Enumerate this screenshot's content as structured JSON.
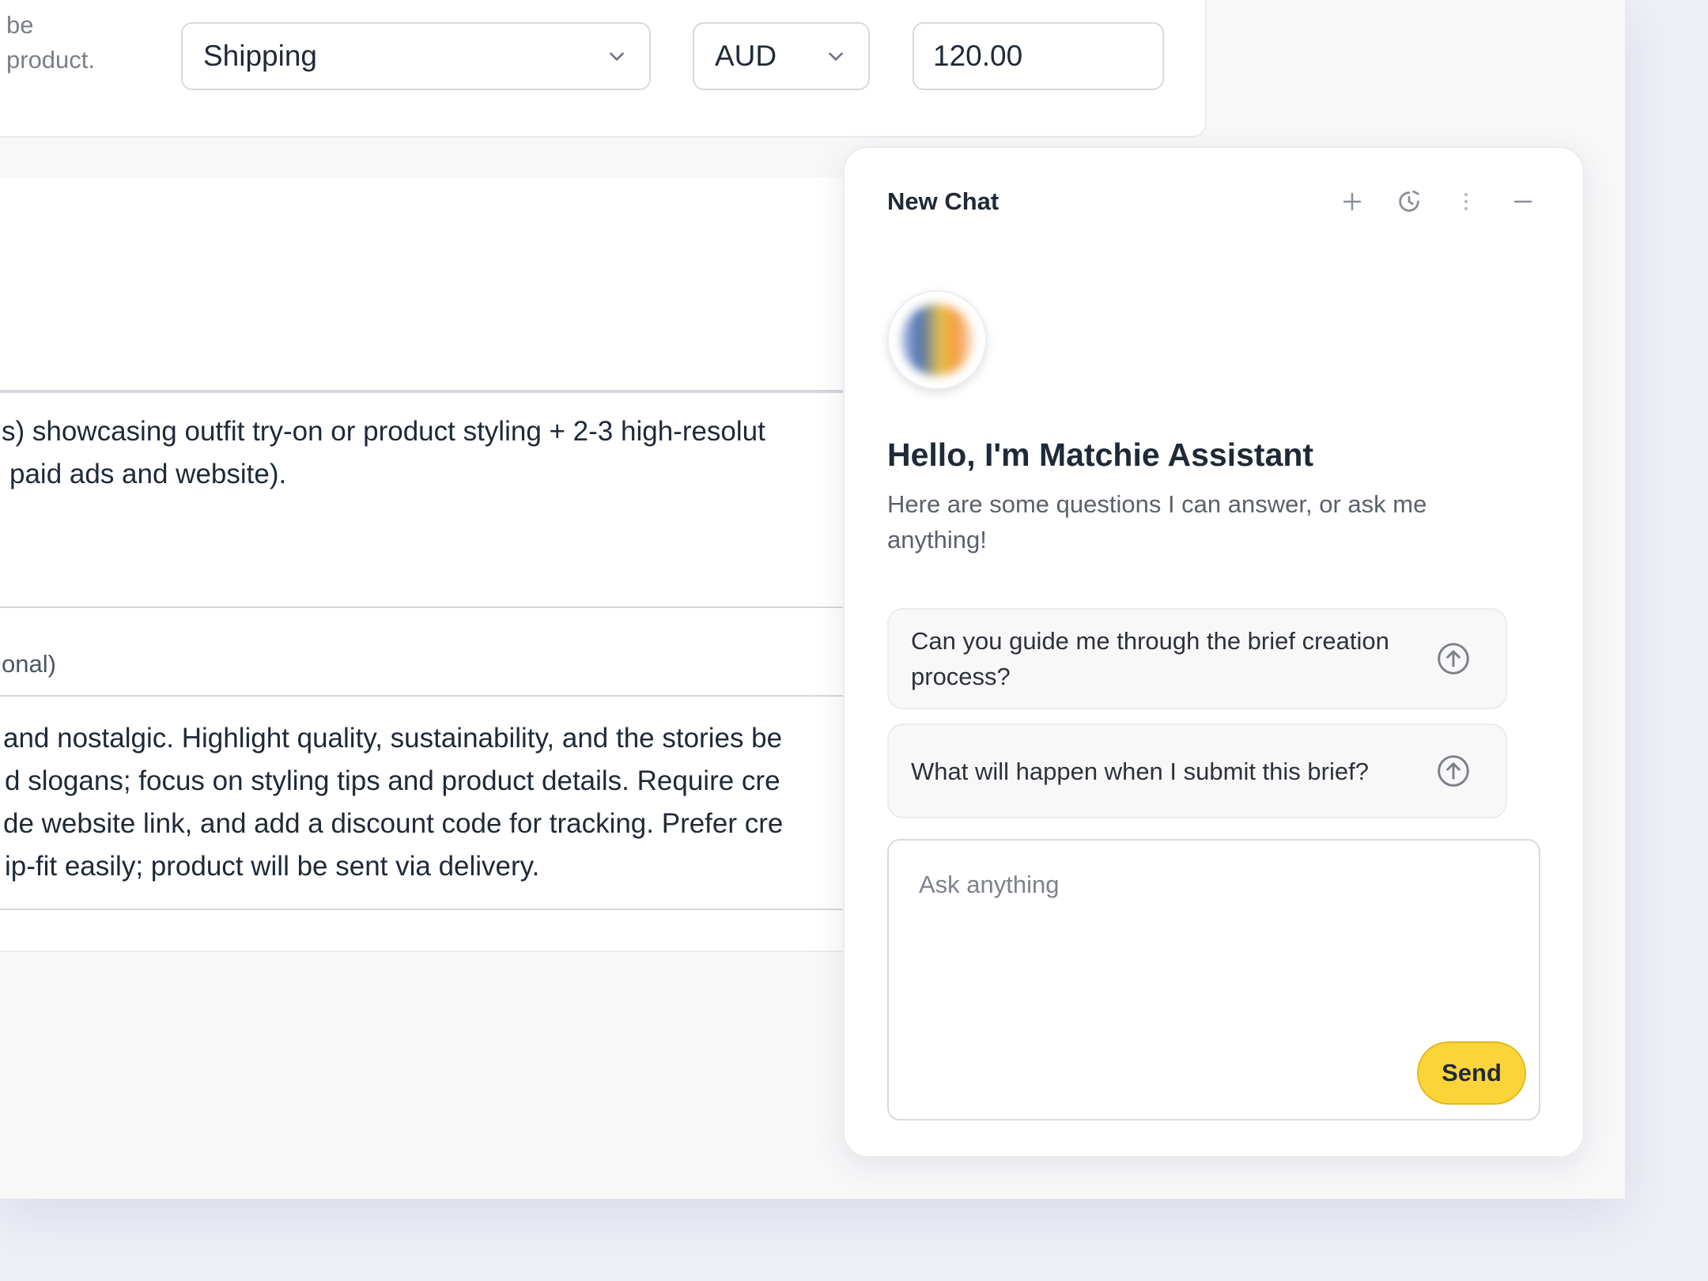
{
  "top_row": {
    "helper_line1": "be",
    "helper_line2": "product.",
    "category_select": "Shipping",
    "currency_select": "AUD",
    "amount_value": "120.00"
  },
  "content": {
    "deliverables": {
      "line1": "s) showcasing outfit try-on or product styling + 2-3 high-resolut",
      "line2": "paid ads and website)."
    },
    "notes": {
      "label": "onal)",
      "lines": [
        "and nostalgic. Highlight quality, sustainability, and the stories be",
        "d slogans; focus on styling tips and product details. Require cre",
        "de website link, and add a discount code for tracking. Prefer cre",
        "ip-fit easily; product will be sent via delivery."
      ]
    }
  },
  "chat": {
    "title": "New Chat",
    "actions": [
      "plus-icon",
      "history-icon",
      "more-vertical-icon",
      "minimize-icon"
    ],
    "greeting": "Hello, I'm Matchie Assistant",
    "subtitle": "Here are some questions I can answer, or ask me anything!",
    "suggestions": [
      "Can you guide me through the brief creation process?",
      "What will happen when I submit this brief?"
    ],
    "input_placeholder": "Ask anything",
    "send_label": "Send",
    "accent_color": "#fbd43a"
  }
}
